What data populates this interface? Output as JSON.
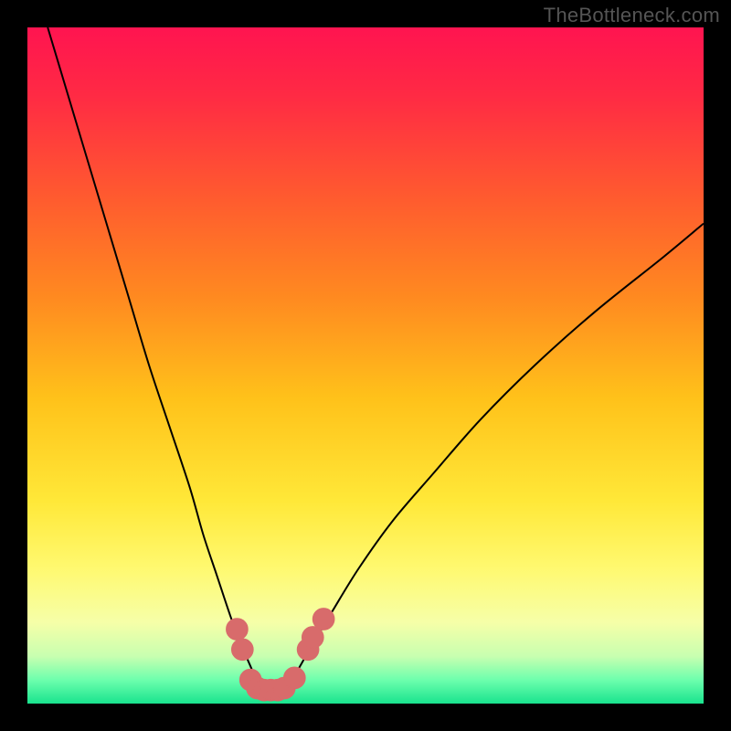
{
  "watermark": "TheBottleneck.com",
  "colors": {
    "bg": "#000000",
    "curve": "#000000",
    "marker_fill": "#d86b6b",
    "marker_stroke": "#d86b6b",
    "gradient_stops": [
      {
        "offset": 0.0,
        "color": "#ff1450"
      },
      {
        "offset": 0.1,
        "color": "#ff2a44"
      },
      {
        "offset": 0.25,
        "color": "#ff5a2f"
      },
      {
        "offset": 0.4,
        "color": "#ff8a20"
      },
      {
        "offset": 0.55,
        "color": "#ffc21a"
      },
      {
        "offset": 0.7,
        "color": "#ffe838"
      },
      {
        "offset": 0.8,
        "color": "#fff970"
      },
      {
        "offset": 0.88,
        "color": "#f6ffa8"
      },
      {
        "offset": 0.93,
        "color": "#c8ffb0"
      },
      {
        "offset": 0.965,
        "color": "#6dffad"
      },
      {
        "offset": 1.0,
        "color": "#19e38e"
      }
    ]
  },
  "chart_data": {
    "type": "line",
    "title": "",
    "xlabel": "",
    "ylabel": "",
    "xlim": [
      0,
      100
    ],
    "ylim": [
      0,
      100
    ],
    "grid": false,
    "series": [
      {
        "name": "bottleneck-curve",
        "x": [
          3,
          6,
          9,
          12,
          15,
          18,
          21,
          24,
          26,
          28,
          30,
          31.5,
          33,
          34,
          35,
          36,
          37,
          38.5,
          40,
          42,
          45,
          49,
          54,
          60,
          67,
          75,
          84,
          94,
          100
        ],
        "y": [
          100,
          90,
          80,
          70,
          60,
          50,
          41,
          32,
          25,
          19,
          13,
          9,
          5.5,
          3.2,
          1.8,
          1.2,
          1.6,
          2.8,
          5,
          8.5,
          13.5,
          20,
          27,
          34,
          42,
          50,
          58,
          66,
          71
        ]
      }
    ],
    "markers": {
      "name": "bottleneck-markers",
      "points": [
        {
          "x": 31.0,
          "y": 11.0
        },
        {
          "x": 31.8,
          "y": 8.0
        },
        {
          "x": 33.0,
          "y": 3.5
        },
        {
          "x": 34.0,
          "y": 2.3
        },
        {
          "x": 35.0,
          "y": 2.0
        },
        {
          "x": 36.0,
          "y": 2.0
        },
        {
          "x": 37.0,
          "y": 2.0
        },
        {
          "x": 38.0,
          "y": 2.3
        },
        {
          "x": 39.5,
          "y": 3.8
        },
        {
          "x": 41.5,
          "y": 8.0
        },
        {
          "x": 42.2,
          "y": 9.8
        },
        {
          "x": 43.8,
          "y": 12.5
        }
      ],
      "radius_data_units": 1.6
    }
  }
}
